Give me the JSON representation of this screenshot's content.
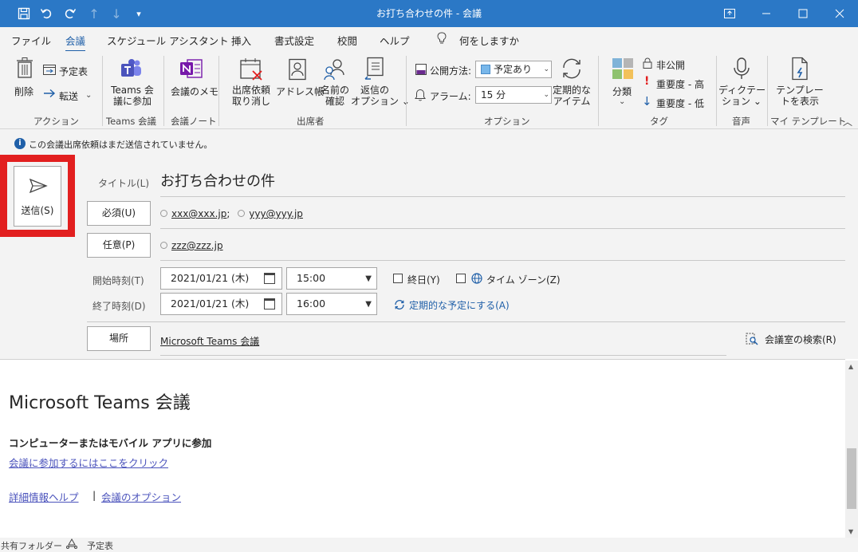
{
  "titlebar": {
    "title": "お打ち合わせの件 - 会議",
    "quick_access": [
      "save-icon",
      "undo-icon",
      "redo-icon",
      "up-icon",
      "down-icon",
      "customize-icon"
    ],
    "window_buttons": [
      "ribbon-display-icon",
      "minimize-icon",
      "maximize-icon",
      "close-icon"
    ]
  },
  "menu": {
    "tabs": [
      "ファイル",
      "会議",
      "スケジュール アシスタント",
      "挿入",
      "書式設定",
      "校閲",
      "ヘルプ"
    ],
    "active": "会議",
    "tell_me": "何をしますか"
  },
  "ribbon": {
    "actions": {
      "delete": "削除",
      "calendar": "予定表",
      "forward": "転送",
      "group": "アクション"
    },
    "teams": {
      "join_line1": "Teams 会",
      "join_line2": "議に参加",
      "group": "Teams 会議"
    },
    "notes": {
      "label": "会議のメモ",
      "group": "会議ノート"
    },
    "attendees": {
      "cancel_line1": "出席依頼",
      "cancel_line2": "取り消し",
      "address_book": "アドレス帳",
      "check_line1": "名前の",
      "check_line2": "確認",
      "response_line1": "返信の",
      "response_line2": "オプション",
      "group": "出席者"
    },
    "options": {
      "show_as_label": "公開方法:",
      "show_as_value": "予定あり",
      "reminder_label": "アラーム:",
      "reminder_value": "15 分",
      "recurring_line1": "定期的な",
      "recurring_line2": "アイテム",
      "group": "オプション"
    },
    "tags": {
      "categorize": "分類",
      "private": "非公開",
      "high": "重要度 - 高",
      "low": "重要度 - 低",
      "group": "タグ"
    },
    "voice": {
      "dictate_line1": "ディクテー",
      "dictate_line2": "ション",
      "group": "音声"
    },
    "templates": {
      "line1": "テンプレー",
      "line2": "トを表示",
      "group": "マイ テンプレート"
    }
  },
  "infobar": {
    "text": "この会議出席依頼はまだ送信されていません。"
  },
  "form": {
    "send_label": "送信(S)",
    "title_label": "タイトル(L)",
    "subject": "お打ち合わせの件",
    "required_label": "必須(U)",
    "required_1": "xxx@xxx.jp",
    "required_sep": ";",
    "required_2": "yyy@yyy.jp",
    "optional_label": "任意(P)",
    "optional_1": "zzz@zzz.jp",
    "start_label": "開始時刻(T)",
    "start_date": "2021/01/21 (木)",
    "start_time": "15:00",
    "allday_label": "終日(Y)",
    "timezone_label": "タイム ゾーン(Z)",
    "end_label": "終了時刻(D)",
    "end_date": "2021/01/21 (木)",
    "end_time": "16:00",
    "recurrence_link": "定期的な予定にする(A)",
    "location_label": "場所",
    "location_value": "Microsoft Teams 会議",
    "room_finder": "会議室の検索(R)"
  },
  "body": {
    "title": "Microsoft Teams 会議",
    "join_heading": "コンピューターまたはモバイル アプリに参加",
    "join_link": "会議に参加するにはここをクリック",
    "help_link": "詳細情報ヘルプ",
    "separator": "|",
    "options_link": "会議のオプション"
  },
  "status": {
    "shared_folder": "共有フォルダー",
    "calendar": "予定表"
  },
  "colors": {
    "titlebar": "#2b78c6",
    "highlight_box": "#e21f1f",
    "link": "#4b53bc",
    "accent": "#1f5fa8"
  }
}
